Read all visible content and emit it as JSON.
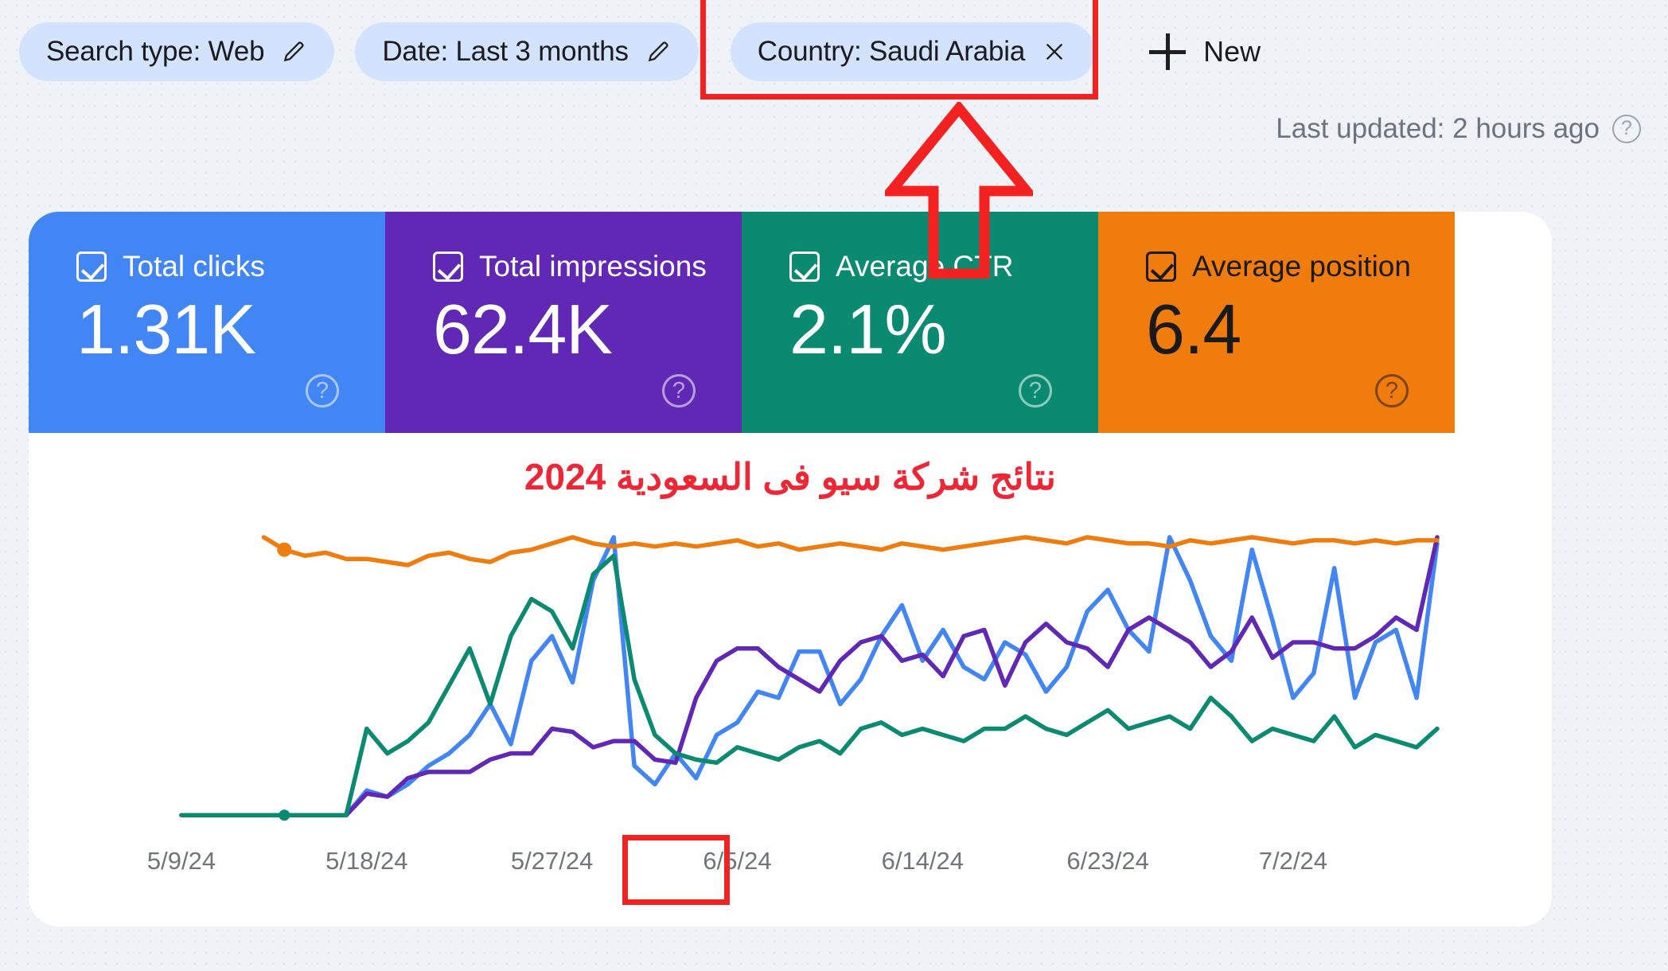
{
  "filter_bar": {
    "chips": [
      {
        "label": "Search type: Web",
        "icon": "pencil-icon",
        "name": "search-type"
      },
      {
        "label": "Date: Last 3 months",
        "icon": "pencil-icon",
        "name": "date"
      },
      {
        "label": "Country: Saudi Arabia",
        "icon": "close-icon",
        "name": "country"
      }
    ],
    "new_button": {
      "label": "New",
      "icon": "plus-icon"
    }
  },
  "status": {
    "last_updated": "Last updated: 2 hours ago",
    "help_glyph": "?"
  },
  "metrics": [
    {
      "label": "Total clicks",
      "value": "1.31K",
      "color": "#4285f4",
      "text_color": "#ffffff",
      "checked": true,
      "help_glyph": "?"
    },
    {
      "label": "Total impressions",
      "value": "62.4K",
      "color": "#6028b5",
      "text_color": "#ffffff",
      "checked": true,
      "help_glyph": "?"
    },
    {
      "label": "Average CTR",
      "value": "2.1%",
      "color": "#0a8a70",
      "text_color": "#ffffff",
      "checked": true,
      "help_glyph": "?"
    },
    {
      "label": "Average position",
      "value": "6.4",
      "color": "#ef7c0c",
      "text_color": "#1a1a1a",
      "checked": true,
      "help_glyph": "?"
    }
  ],
  "chart_title": "نتائج شركة سيو فى السعودية 2024",
  "annotations": {
    "arrow": {
      "color": "#f42121",
      "points_to": "Country: Saudi Arabia"
    },
    "country_box": {
      "color": "#f42121"
    },
    "date_box": {
      "color": "#f42121",
      "target": "6/5/24"
    }
  },
  "chart_data": {
    "type": "line",
    "title": "نتائج شركة سيو فى السعودية 2024",
    "xlabel": "",
    "ylabel": "",
    "grid": false,
    "legend": "none",
    "x_tick_labels": [
      "5/9/24",
      "5/18/24",
      "5/27/24",
      "6/5/24",
      "6/14/24",
      "6/23/24",
      "7/2/24"
    ],
    "x_tick_positions": [
      0,
      9,
      18,
      27,
      36,
      45,
      54
    ],
    "x_count": 62,
    "ylim": [
      0,
      100
    ],
    "series": [
      {
        "name": "Total clicks",
        "color": "#4285f4",
        "values": [
          2,
          2,
          2,
          2,
          2,
          2,
          2,
          2,
          2,
          10,
          8,
          12,
          18,
          22,
          28,
          38,
          25,
          52,
          60,
          45,
          78,
          92,
          18,
          12,
          22,
          14,
          28,
          32,
          42,
          40,
          55,
          55,
          38,
          46,
          60,
          70,
          52,
          62,
          50,
          46,
          58,
          54,
          42,
          50,
          68,
          75,
          62,
          55,
          92,
          78,
          60,
          52,
          88,
          65,
          40,
          48,
          82,
          40,
          58,
          62,
          40,
          90
        ]
      },
      {
        "name": "Total impressions",
        "color": "#6028b5",
        "values": [
          2,
          2,
          2,
          2,
          2,
          2,
          2,
          2,
          2,
          9,
          8,
          14,
          16,
          16,
          16,
          20,
          22,
          22,
          30,
          29,
          24,
          26,
          26,
          20,
          19,
          40,
          52,
          56,
          56,
          50,
          46,
          42,
          52,
          58,
          60,
          52,
          54,
          47,
          60,
          62,
          44,
          58,
          64,
          58,
          56,
          50,
          62,
          66,
          62,
          58,
          50,
          55,
          66,
          53,
          58,
          58,
          56,
          56,
          60,
          66,
          62,
          92
        ]
      },
      {
        "name": "Average CTR",
        "color": "#0a8a70",
        "values": [
          2,
          2,
          2,
          2,
          2,
          2,
          2,
          2,
          2,
          30,
          22,
          26,
          32,
          44,
          56,
          38,
          60,
          72,
          68,
          56,
          80,
          86,
          46,
          28,
          22,
          20,
          19,
          24,
          22,
          20,
          24,
          26,
          22,
          30,
          32,
          28,
          30,
          28,
          26,
          30,
          30,
          34,
          30,
          28,
          32,
          36,
          30,
          32,
          34,
          30,
          40,
          34,
          26,
          30,
          28,
          26,
          34,
          24,
          28,
          26,
          24,
          30
        ]
      },
      {
        "name": "Average position",
        "color": "#ef7c0c",
        "values": [
          null,
          null,
          null,
          null,
          92,
          88,
          86,
          87,
          85,
          85,
          84,
          83,
          86,
          87,
          85,
          84,
          87,
          88,
          90,
          92,
          90,
          89,
          90,
          89,
          90,
          89,
          90,
          91,
          89,
          90,
          88,
          89,
          90,
          89,
          88,
          90,
          89,
          88,
          89,
          90,
          91,
          92,
          91,
          90,
          92,
          91,
          90,
          90,
          89,
          91,
          90,
          91,
          92,
          91,
          90,
          91,
          91,
          90,
          91,
          90,
          91,
          91
        ]
      }
    ],
    "markers": [
      {
        "series": "Average position",
        "x_index": 5,
        "note": "isolated orange dot",
        "color": "#ef7c0c"
      },
      {
        "series": "Average CTR",
        "x_index": 5,
        "note": "teal dot on baseline",
        "color": "#0a8a70"
      }
    ]
  }
}
